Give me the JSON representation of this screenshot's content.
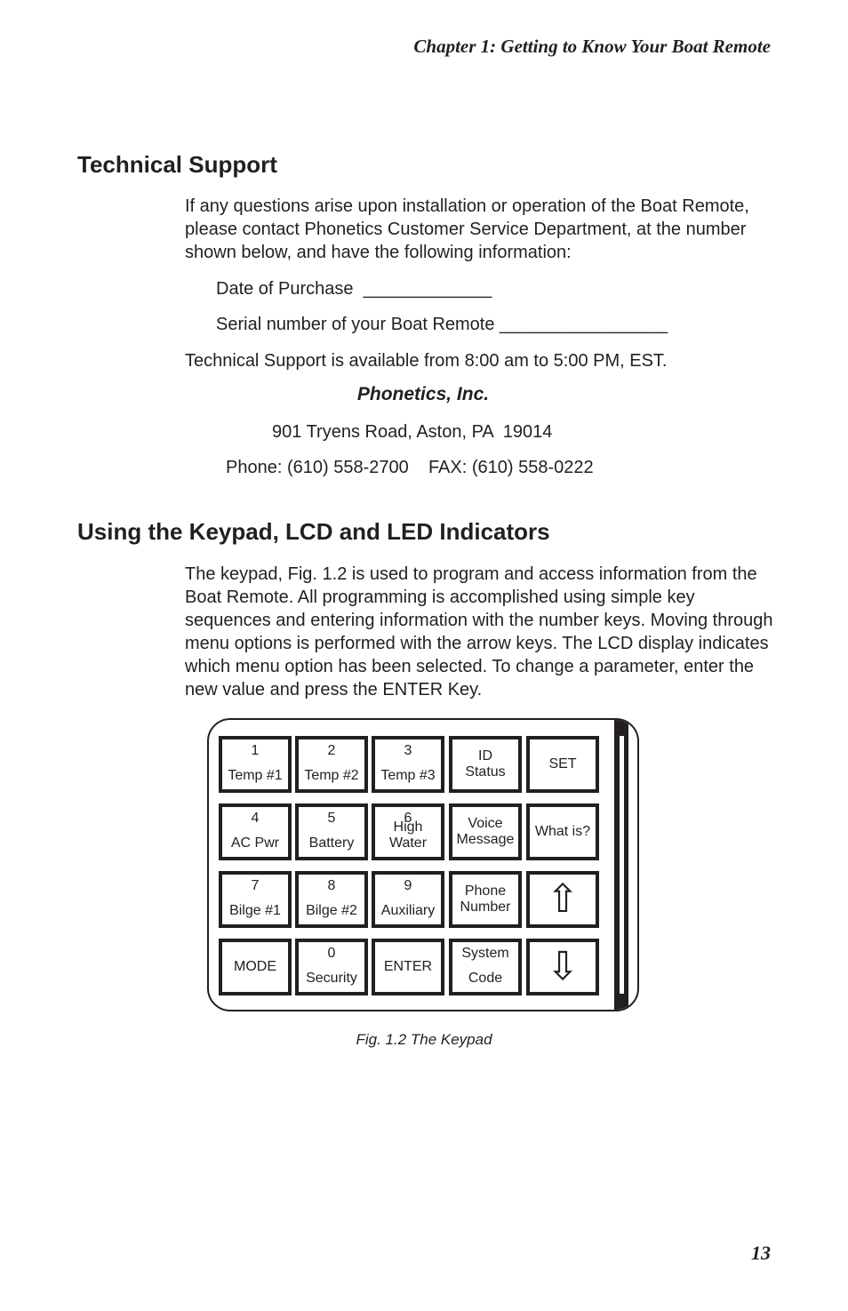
{
  "header": {
    "running_head": "Chapter 1:  Getting to Know Your Boat Remote"
  },
  "technical_support": {
    "heading": "Technical Support",
    "intro": "If any questions arise upon installation or operation of the Boat Remote, please contact Phonetics Customer Service Department, at the number shown below, and have the following information:",
    "date_of_purchase": "Date of Purchase  _____________",
    "serial_number": "Serial number of your Boat Remote _________________",
    "hours": "Technical Support is available from 8:00 am to 5:00 PM, EST.",
    "company": "Phonetics, Inc.",
    "address": "901 Tryens Road, Aston, PA  19014",
    "phone_fax": "Phone: (610) 558-2700    FAX: (610) 558-0222"
  },
  "keypad_section": {
    "heading": "Using the Keypad, LCD and LED Indicators",
    "body": "The keypad, Fig. 1.2 is used to program and access information from the Boat Remote. All programming is accomplished using simple key sequences and entering information with the number keys. Moving through menu options is performed with the arrow keys. The LCD display indicates which menu option has been selected. To change a parameter, enter the new value and press the ENTER Key."
  },
  "keypad": {
    "keys": [
      {
        "top": "1",
        "bottom": "Temp #1"
      },
      {
        "top": "2",
        "bottom": "Temp #2"
      },
      {
        "top": "3",
        "bottom": "Temp #3"
      },
      {
        "mid": "ID\nStatus"
      },
      {
        "mid": "SET"
      },
      {
        "top": "4",
        "bottom": "AC  Pwr"
      },
      {
        "top": "5",
        "bottom": "Battery"
      },
      {
        "top": "6",
        "bottom": "High\nWater"
      },
      {
        "mid": "Voice\nMessage"
      },
      {
        "mid": "What is?"
      },
      {
        "top": "7",
        "bottom": "Bilge #1"
      },
      {
        "top": "8",
        "bottom": "Bilge #2"
      },
      {
        "top": "9",
        "bottom": "Auxiliary"
      },
      {
        "mid": "Phone\nNumber"
      },
      {
        "arrow": "⇧",
        "icon": "up-arrow-icon"
      },
      {
        "mid": "MODE"
      },
      {
        "top": "0",
        "bottom": "Security"
      },
      {
        "mid": "ENTER"
      },
      {
        "top": "System",
        "bottom": "Code"
      },
      {
        "arrow": "⇩",
        "icon": "down-arrow-icon"
      }
    ],
    "caption": "Fig. 1.2 The Keypad"
  },
  "footer": {
    "page_number": "13"
  }
}
